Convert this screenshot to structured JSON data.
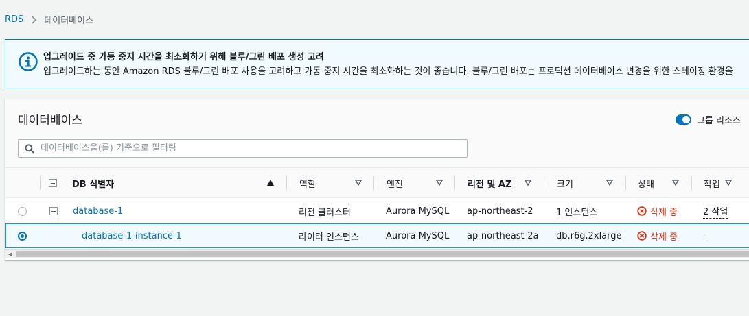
{
  "breadcrumb": {
    "root": "RDS",
    "current": "데이터베이스"
  },
  "alert": {
    "title": "업그레이드 중 가동 중지 시간을 최소화하기 위해 블루/그린 배포 생성 고려",
    "body": "업그레이드하는 동안 Amazon RDS 블루/그린 배포 사용을 고려하고 가동 중지 시간을 최소화하는 것이 좋습니다. 블루/그린 배포는 프로덕션 데이터베이스 변경을 위한 스테이징 환경을 ",
    "icon": "info-icon"
  },
  "panel": {
    "title": "데이터베이스",
    "group_toggle_label": "그룹 리소스",
    "group_toggle_on": true,
    "search_placeholder": "데이터베이스을(를) 기준으로 필터링"
  },
  "table": {
    "columns": {
      "identifier": "DB 식별자",
      "role": "역할",
      "engine": "엔진",
      "region_az": "리전 및 AZ",
      "size": "크기",
      "status": "상태",
      "actions": "작업"
    },
    "rows": [
      {
        "identifier": "database-1",
        "role": "리전 클러스터",
        "engine": "Aurora MySQL",
        "region_az": "ap-northeast-2",
        "size": "1 인스턴스",
        "status": "삭제 중",
        "actions": "2 작업",
        "selected": false
      },
      {
        "identifier": "database-1-instance-1",
        "role": "라이터 인스턴스",
        "engine": "Aurora MySQL",
        "region_az": "ap-northeast-2a",
        "size": "db.r6g.2xlarge",
        "status": "삭제 중",
        "actions": "-",
        "selected": true
      }
    ]
  },
  "colors": {
    "link": "#0073bb",
    "status_deleting": "#d13212",
    "alert_bg": "#f1faff",
    "alert_border": "#0073bb"
  }
}
